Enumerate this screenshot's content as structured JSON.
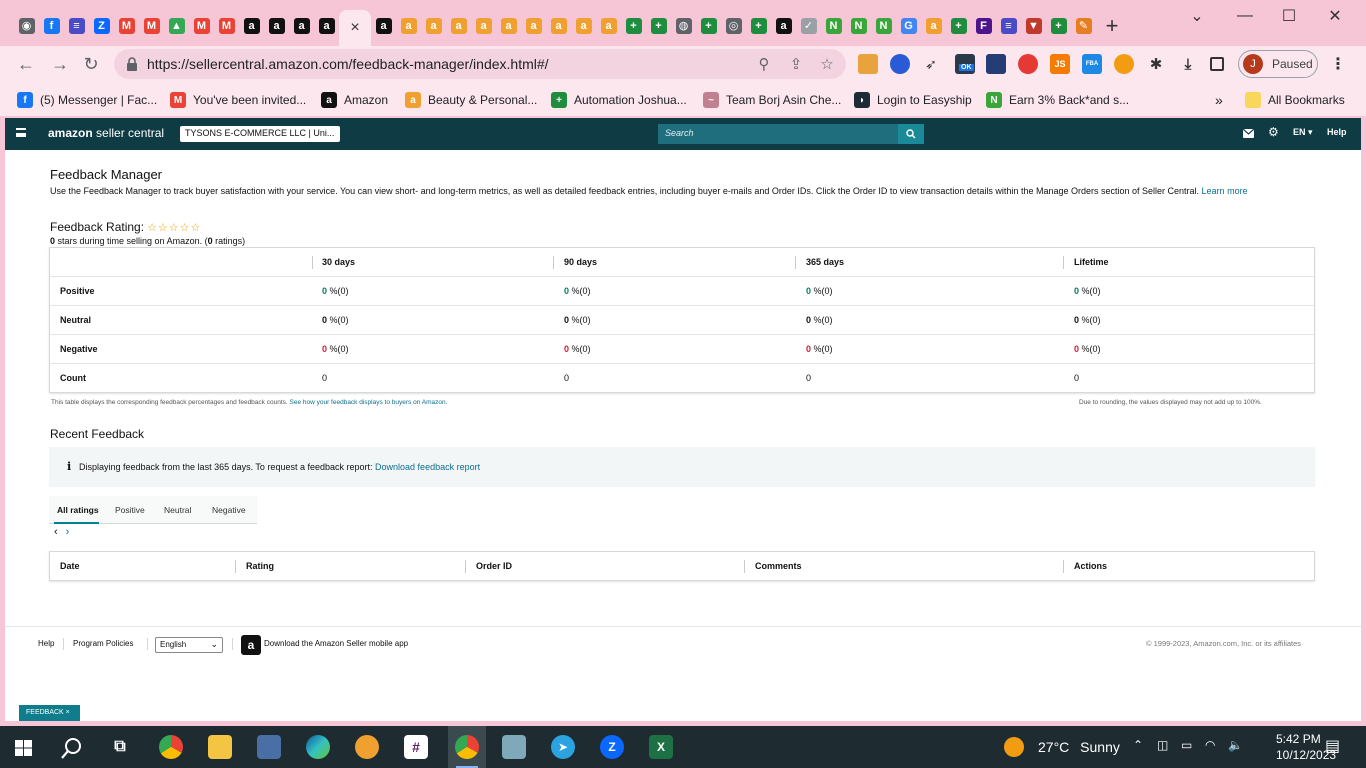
{
  "browser": {
    "tab_icons": [
      {
        "icon": "chrome-icon",
        "color": "#5f6368",
        "glyph": "◉"
      },
      {
        "icon": "facebook-icon",
        "color": "#1877f2",
        "glyph": "f"
      },
      {
        "icon": "list-icon",
        "color": "#4b4bc8",
        "glyph": "≡"
      },
      {
        "icon": "zalo-icon",
        "color": "#0a68fe",
        "glyph": "Z"
      },
      {
        "icon": "gmail-icon",
        "color": "#ea4335",
        "glyph": "M"
      },
      {
        "icon": "gmail-icon",
        "color": "#ea4335",
        "glyph": "M"
      },
      {
        "icon": "google-drive-icon",
        "color": "#34a853",
        "glyph": "▲"
      },
      {
        "icon": "gmail-icon",
        "color": "#ea4335",
        "glyph": "M"
      },
      {
        "icon": "gmail-icon",
        "color": "#ea4335",
        "glyph": "M"
      },
      {
        "icon": "amazon-icon",
        "color": "#111111",
        "glyph": "a"
      },
      {
        "icon": "amazon-icon",
        "color": "#111111",
        "glyph": "a"
      },
      {
        "icon": "amazon-icon",
        "color": "#111111",
        "glyph": "a"
      },
      {
        "icon": "amazon-icon",
        "color": "#111111",
        "glyph": "a"
      }
    ],
    "tab_icons_after": [
      {
        "icon": "amazon-icon",
        "color": "#111111",
        "glyph": "a"
      },
      {
        "icon": "amazon-icon",
        "color": "#f0a030",
        "glyph": "a"
      },
      {
        "icon": "amazon-icon",
        "color": "#f0a030",
        "glyph": "a"
      },
      {
        "icon": "amazon-icon",
        "color": "#f0a030",
        "glyph": "a"
      },
      {
        "icon": "amazon-icon",
        "color": "#f0a030",
        "glyph": "a"
      },
      {
        "icon": "amazon-icon",
        "color": "#f0a030",
        "glyph": "a"
      },
      {
        "icon": "amazon-icon",
        "color": "#f0a030",
        "glyph": "a"
      },
      {
        "icon": "amazon-icon",
        "color": "#f0a030",
        "glyph": "a"
      },
      {
        "icon": "amazon-icon",
        "color": "#f0a030",
        "glyph": "a"
      },
      {
        "icon": "amazon-icon",
        "color": "#f0a030",
        "glyph": "a"
      },
      {
        "icon": "google-sheets-icon",
        "color": "#1e8e3e",
        "glyph": "+"
      },
      {
        "icon": "google-sheets-icon",
        "color": "#1e8e3e",
        "glyph": "+"
      },
      {
        "icon": "globe-icon",
        "color": "#5f6368",
        "glyph": "◍"
      },
      {
        "icon": "google-sheets-icon",
        "color": "#1e8e3e",
        "glyph": "+"
      },
      {
        "icon": "record-icon",
        "color": "#5f6368",
        "glyph": "◎"
      },
      {
        "icon": "google-sheets-icon",
        "color": "#1e8e3e",
        "glyph": "+"
      },
      {
        "icon": "amazon-icon",
        "color": "#111111",
        "glyph": "a"
      },
      {
        "icon": "leaf-icon",
        "color": "#9aa0a6",
        "glyph": "✓"
      },
      {
        "icon": "cashback-icon",
        "color": "#3aa63a",
        "glyph": "N"
      },
      {
        "icon": "cashback-icon",
        "color": "#3aa63a",
        "glyph": "N"
      },
      {
        "icon": "cashback-icon",
        "color": "#3aa63a",
        "glyph": "N"
      },
      {
        "icon": "google-icon",
        "color": "#4285f4",
        "glyph": "G"
      },
      {
        "icon": "amazon-icon",
        "color": "#f0a030",
        "glyph": "a"
      },
      {
        "icon": "google-sheets-icon",
        "color": "#1e8e3e",
        "glyph": "+"
      },
      {
        "icon": "fedex-icon",
        "color": "#4d148c",
        "glyph": "F"
      },
      {
        "icon": "list-icon",
        "color": "#4b4bc8",
        "glyph": "≡"
      },
      {
        "icon": "flag-icon",
        "color": "#c0392b",
        "glyph": "▼"
      },
      {
        "icon": "google-sheets-icon",
        "color": "#1e8e3e",
        "glyph": "+"
      },
      {
        "icon": "pencil-icon",
        "color": "#e67e22",
        "glyph": "✎"
      }
    ],
    "active_tab_close": "×",
    "new_tab": "+",
    "url": "https://sellercentral.amazon.com/feedback-manager/index.html#/",
    "profile_initial": "J",
    "profile_status": "Paused",
    "ext_badge": "OK",
    "ext_js": "JS",
    "ext_fba": "FBA",
    "bookmarks": [
      {
        "label": "(5) Messenger | Fac...",
        "icon": "messenger-icon",
        "color": "#1877f2",
        "glyph": "f"
      },
      {
        "label": "You've been invited...",
        "icon": "gmail-icon",
        "color": "#ea4335",
        "glyph": "M"
      },
      {
        "label": "Amazon",
        "icon": "amazon-icon",
        "color": "#111111",
        "glyph": "a"
      },
      {
        "label": "Beauty & Personal...",
        "icon": "amazon-icon",
        "color": "#f0a030",
        "glyph": "a"
      },
      {
        "label": "Automation Joshua...",
        "icon": "google-sheets-icon",
        "color": "#1e8e3e",
        "glyph": "+"
      },
      {
        "label": "Team Borj Asin Che...",
        "icon": "team-icon",
        "color": "#c08090",
        "glyph": "~"
      },
      {
        "label": "Login to Easyship",
        "icon": "easyship-icon",
        "color": "#1d2b36",
        "glyph": "◗"
      },
      {
        "label": "Earn 3% Back*and s...",
        "icon": "cashback-icon",
        "color": "#3aa63a",
        "glyph": "N"
      }
    ],
    "bookmarks_more": "»",
    "all_bookmarks": "All Bookmarks"
  },
  "seller_nav": {
    "brand_bold": "amazon",
    "brand_rest": " seller central",
    "account": "TYSONS E-COMMERCE LLC | Uni...",
    "search_placeholder": "Search",
    "lang": "EN ▾",
    "help": "Help"
  },
  "feedback": {
    "title": "Feedback Manager",
    "description": "Use the Feedback Manager to track buyer satisfaction with your service. You can view short- and long-term metrics, as well as detailed feedback entries, including buyer e-mails and Order IDs. Click the Order ID to view transaction details within the Manage Orders section of Seller Central.",
    "learn_more": "Learn more",
    "rating_label": "Feedback Rating:",
    "stars": "☆☆☆☆☆",
    "rating_stars_value": "0",
    "rating_mid": " stars during time selling on Amazon. (",
    "rating_count": "0",
    "rating_end": " ratings)",
    "columns": [
      "30 days",
      "90 days",
      "365 days",
      "Lifetime"
    ],
    "rows": [
      {
        "label": "Positive",
        "values": [
          "0",
          "0",
          "0",
          "0"
        ],
        "suffix": " %(0)"
      },
      {
        "label": "Neutral",
        "values": [
          "0",
          "0",
          "0",
          "0"
        ],
        "suffix": " %(0)"
      },
      {
        "label": "Negative",
        "values": [
          "0",
          "0",
          "0",
          "0"
        ],
        "suffix": " %(0)"
      },
      {
        "label": "Count",
        "values": [
          "0",
          "0",
          "0",
          "0"
        ],
        "suffix": ""
      }
    ],
    "note_left": "This table displays the corresponding feedback percentages and feedback counts.",
    "note_left_link": "See how your feedback displays to buyers on Amazon.",
    "note_right": "Due to rounding, the values displayed may not add up to 100%.",
    "colors": {
      "positive": "#067d62",
      "negative": "#cc1c39",
      "accent": "#008296"
    }
  },
  "recent": {
    "title": "Recent Feedback",
    "info_icon": "i",
    "info_text": "Displaying feedback from the last 365 days. To request a feedback report:",
    "info_link": "Download feedback report",
    "tabs": [
      "All ratings",
      "Positive",
      "Neutral",
      "Negative"
    ],
    "pager_prev": "‹",
    "pager_next": "›",
    "columns": [
      "Date",
      "Rating",
      "Order ID",
      "Comments",
      "Actions"
    ]
  },
  "footer": {
    "help": "Help",
    "policies": "Program Policies",
    "language": "English",
    "app_text": "Download the Amazon Seller mobile app",
    "copyright": "© 1999-2023, Amazon.com, Inc. or its affiliates",
    "feedback_btn": "FEEDBACK ×"
  },
  "taskbar": {
    "weather_temp": "27°C",
    "weather_desc": "Sunny",
    "time": "5:42 PM",
    "date": "10/12/2023"
  }
}
